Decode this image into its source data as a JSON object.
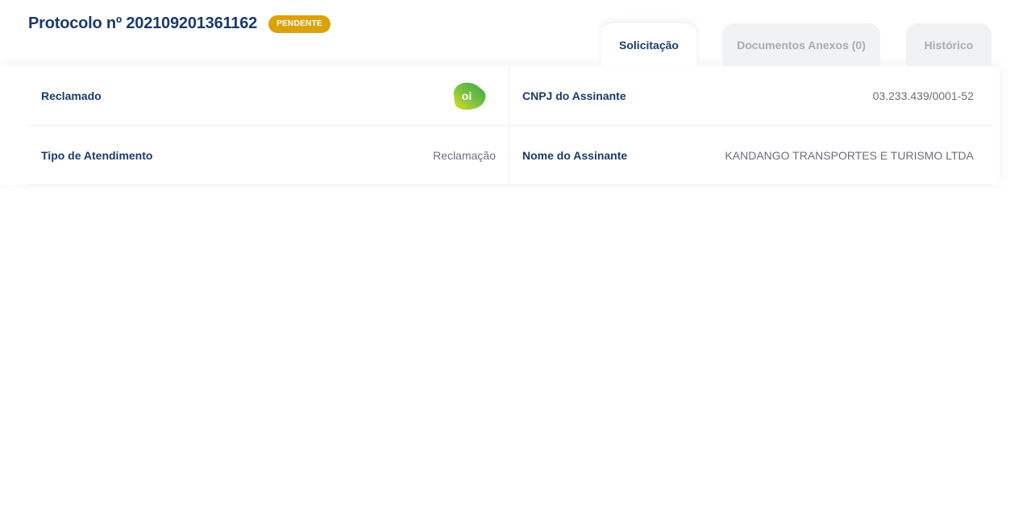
{
  "header": {
    "title": "Protocolo nº 202109201361162",
    "status": "PENDENTE"
  },
  "tabs": [
    {
      "label": "Solicitação",
      "active": true
    },
    {
      "label": "Documentos Anexos (0)",
      "active": false
    },
    {
      "label": "Histórico",
      "active": false
    }
  ],
  "details": {
    "reclamado": {
      "label": "Reclamado",
      "logo_text": "oi",
      "icon": "oi-logo-icon"
    },
    "cnpj": {
      "label": "CNPJ do Assinante",
      "value": "03.233.439/0001-52"
    },
    "tipo": {
      "label": "Tipo de Atendimento",
      "value": "Reclamação"
    },
    "nome": {
      "label": "Nome do Assinante",
      "value": "KANDANGO TRANSPORTES E TURISMO LTDA"
    }
  },
  "colors": {
    "primary": "#1b3a6b",
    "status": "#dba20a",
    "logo_green": "#4cb848",
    "logo_yellow": "#c9d92a"
  }
}
